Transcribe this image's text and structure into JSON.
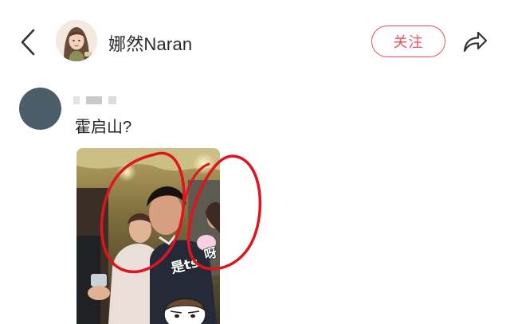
{
  "header": {
    "author_name": "娜然Naran",
    "follow_label": "关注",
    "back_icon": "chevron-left-icon",
    "share_icon": "share-arrow-icon"
  },
  "comment": {
    "text": "霍启山?",
    "image": {
      "sticker_text": "是ts",
      "sticker_exclaim": "呀"
    }
  },
  "colors": {
    "accent": "#e8515f",
    "annotation_red": "#e0141e",
    "avatar_placeholder": "#4c5d6a"
  }
}
